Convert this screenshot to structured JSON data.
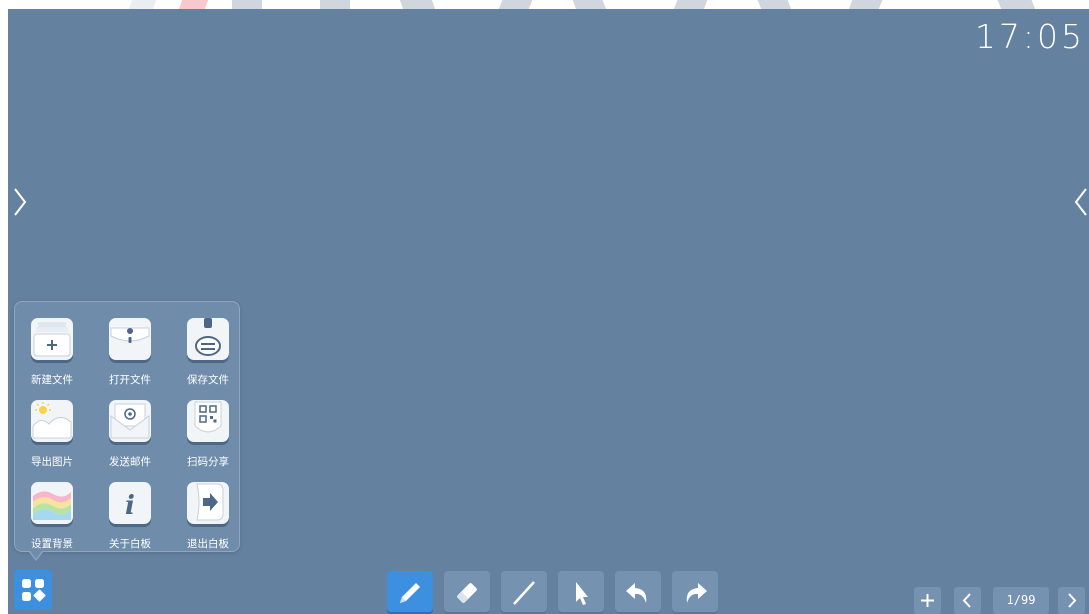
{
  "clock": "17:05",
  "menu": {
    "items": [
      {
        "label": "新建文件",
        "icon": "new-file-icon"
      },
      {
        "label": "打开文件",
        "icon": "open-file-icon"
      },
      {
        "label": "保存文件",
        "icon": "save-file-icon"
      },
      {
        "label": "导出图片",
        "icon": "export-image-icon"
      },
      {
        "label": "发送邮件",
        "icon": "send-email-icon"
      },
      {
        "label": "扫码分享",
        "icon": "qr-share-icon"
      },
      {
        "label": "设置背景",
        "icon": "set-background-icon"
      },
      {
        "label": "关于白板",
        "icon": "about-whiteboard-icon"
      },
      {
        "label": "退出白板",
        "icon": "exit-whiteboard-icon"
      }
    ]
  },
  "toolbar": {
    "tools": [
      {
        "name": "pen",
        "icon": "pen-icon",
        "active": true
      },
      {
        "name": "eraser",
        "icon": "eraser-icon",
        "active": false
      },
      {
        "name": "line",
        "icon": "line-icon",
        "active": false
      },
      {
        "name": "select",
        "icon": "pointer-icon",
        "active": false
      },
      {
        "name": "undo",
        "icon": "undo-icon",
        "active": false
      },
      {
        "name": "redo",
        "icon": "redo-icon",
        "active": false
      }
    ]
  },
  "pagination": {
    "current": 1,
    "total": 99,
    "label": "1/99"
  },
  "colors": {
    "background": "#6482a0",
    "accent": "#3d8fe0",
    "panel": "#6f8dab",
    "text": "#ffffff"
  }
}
